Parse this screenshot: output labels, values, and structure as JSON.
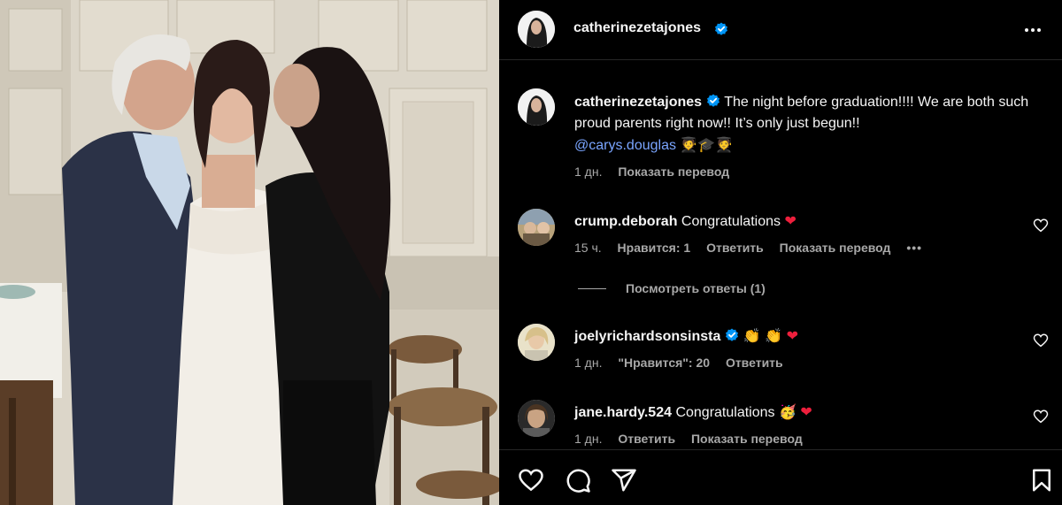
{
  "post": {
    "author": "catherinezetajones",
    "more_icon": "more-horizontal-icon",
    "caption_text": "The night before graduation!!!! We are both such proud parents right now!! It’s only just begun!!",
    "mention": "@carys.douglas",
    "caption_emojis": "🧑‍🎓🎓🧑‍🎓",
    "time": "1 дн.",
    "translate": "Показать перевод"
  },
  "comments": [
    {
      "user": "crump.deborah",
      "text": "Congratulations",
      "emoji": "❤",
      "time": "15 ч.",
      "likes": "Нравится: 1",
      "reply": "Ответить",
      "translate": "Показать перевод",
      "more": "•••"
    },
    {
      "user": "joelyrichardsonsinsta",
      "emoji1": "👏",
      "emoji2": "👏",
      "emoji3": "❤",
      "time": "1 дн.",
      "likes": "\"Нравится\": 20",
      "reply": "Ответить"
    },
    {
      "user": "jane.hardy.524",
      "text": "Congratulations",
      "emoji1": "🥳",
      "emoji2": "❤",
      "time": "1 дн.",
      "reply": "Ответить",
      "translate": "Показать перевод"
    }
  ],
  "view_replies": "Посмотреть ответы (1)",
  "colors": {
    "background": "#000000",
    "text": "#f5f5f5",
    "secondary": "#a8a8a8",
    "link": "#7aa5ff",
    "verified": "#0095f6",
    "heart": "#ed1f3c"
  },
  "icons": {
    "like": "heart-outline-icon",
    "comment": "comment-bubble-icon",
    "share": "paper-plane-icon",
    "save": "bookmark-icon"
  }
}
